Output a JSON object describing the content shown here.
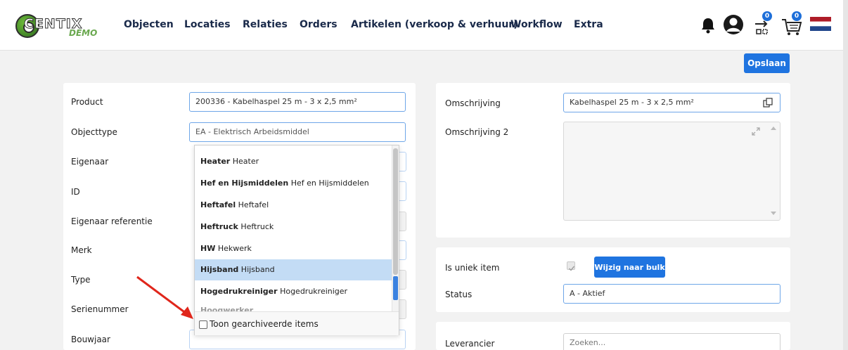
{
  "brand": {
    "logo_text": "CENTIX",
    "logo_sub": "DEMO"
  },
  "nav": {
    "items": [
      "Objecten",
      "Locaties",
      "Relaties",
      "Orders",
      "Artikelen (verkoop & verhuur)",
      "Workflow",
      "Extra"
    ]
  },
  "header_icons": {
    "notifications": "bell-icon",
    "account": "user-circle-icon",
    "scan": {
      "icon": "scan-transfer-icon",
      "badge": "0"
    },
    "cart": {
      "icon": "cart-icon",
      "badge": "0"
    },
    "language": "dutch-flag-icon"
  },
  "actions": {
    "save_label": "Opslaan"
  },
  "left_form": {
    "fields": [
      {
        "label": "Product",
        "value": "200336 - Kabelhaspel 25 m - 3 x 2,5 mm²"
      },
      {
        "label": "Objecttype",
        "value": "EA - Elektrisch Arbeidsmiddel"
      },
      {
        "label": "Eigenaar",
        "value": ""
      },
      {
        "label": "ID",
        "value": ""
      },
      {
        "label": "Eigenaar referentie",
        "value": ""
      },
      {
        "label": "Merk",
        "value": ""
      },
      {
        "label": "Type",
        "value": ""
      },
      {
        "label": "Serienummer",
        "value": ""
      },
      {
        "label": "Bouwjaar",
        "value": ""
      }
    ]
  },
  "objecttype_dropdown": {
    "options": [
      {
        "code": "Heater",
        "name": "Heater"
      },
      {
        "code": "Hef en Hijsmiddelen",
        "name": "Hef en Hijsmiddelen"
      },
      {
        "code": "Heftafel",
        "name": "Heftafel"
      },
      {
        "code": "Heftruck",
        "name": "Heftruck"
      },
      {
        "code": "HW",
        "name": "Hekwerk"
      },
      {
        "code": "Hijsband",
        "name": "Hijsband"
      },
      {
        "code": "Hogedrukreiniger",
        "name": "Hogedrukreiniger"
      }
    ],
    "selected_index": 5,
    "archived_checkbox_label": "Toon gearchiveerde items",
    "archived_checked": false
  },
  "right_top": {
    "omschrijving_label": "Omschrijving",
    "omschrijving_value": "Kabelhaspel 25 m - 3 x 2,5 mm²",
    "omschrijving2_label": "Omschrijving 2",
    "omschrijving2_value": ""
  },
  "right_mid": {
    "uniek_label": "Is uniek item",
    "uniek_checked": true,
    "bulk_button": "Wijzig naar bulk",
    "status_label": "Status",
    "status_value": "A - Aktief"
  },
  "right_bot": {
    "leverancier_label": "Leverancier",
    "leverancier_placeholder": "Zoeken..."
  },
  "colors": {
    "accent": "#1f74e0",
    "selected_row": "#c3dcf5",
    "annotation_arrow": "#e0261b"
  }
}
